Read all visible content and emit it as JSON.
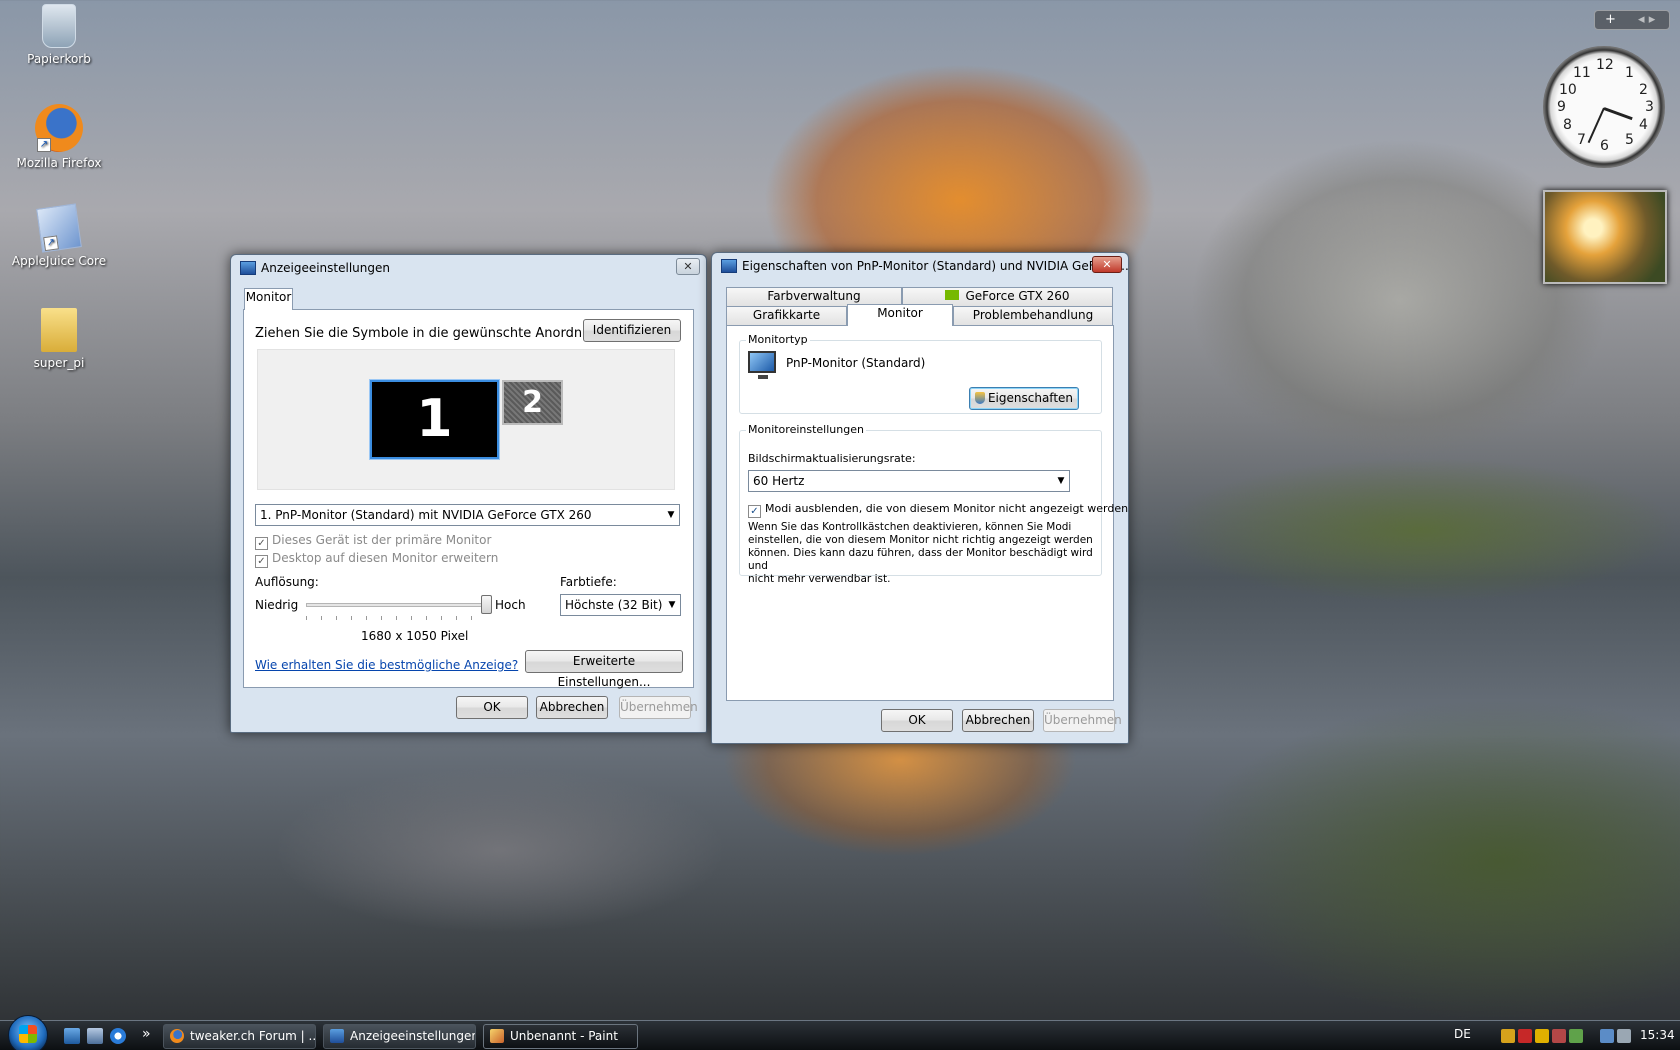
{
  "desktop": {
    "icons": [
      {
        "label": "Papierkorb",
        "icon": "recycle-bin-icon"
      },
      {
        "label": "Mozilla Firefox",
        "icon": "firefox-icon"
      },
      {
        "label": "AppleJuice Core",
        "icon": "applejuice-icon"
      },
      {
        "label": "super_pi",
        "icon": "folder-icon"
      }
    ]
  },
  "gadgets": {
    "sidebar_controls": "+",
    "clock_numbers": [
      "12",
      "1",
      "2",
      "3",
      "4",
      "5",
      "6",
      "7",
      "8",
      "9",
      "10",
      "11"
    ]
  },
  "display_settings": {
    "title": "Anzeigeeinstellungen",
    "tab": "Monitor",
    "instruction": "Ziehen Sie die Symbole in die gewünschte Anordnung.",
    "identify_button": "Identifizieren",
    "monitor_1": "1",
    "monitor_2": "2",
    "monitor_select": "1. PnP-Monitor (Standard) mit NVIDIA GeForce GTX 260",
    "primary_checkbox": "Dieses Gerät ist der primäre Monitor",
    "extend_checkbox": "Desktop auf diesen Monitor erweitern",
    "resolution_label": "Auflösung:",
    "low_label": "Niedrig",
    "high_label": "Hoch",
    "resolution_value": "1680 x 1050 Pixel",
    "resolution_slider_fraction": 1.0,
    "color_depth_label": "Farbtiefe:",
    "color_depth_value": "Höchste (32 Bit)",
    "help_link": "Wie erhalten Sie die bestmögliche Anzeige?",
    "advanced_button": "Erweiterte Einstellungen...",
    "ok": "OK",
    "cancel": "Abbrechen",
    "apply": "Übernehmen"
  },
  "monitor_properties": {
    "title": "Eigenschaften von PnP-Monitor (Standard) und NVIDIA GeForce...",
    "tabs_back": [
      "Farbverwaltung",
      "GeForce GTX 260"
    ],
    "tabs_front": [
      "Grafikkarte",
      "Monitor",
      "Problembehandlung"
    ],
    "active_tab": "Monitor",
    "monitor_type_group": "Monitortyp",
    "monitor_name": "PnP-Monitor (Standard)",
    "properties_button": "Eigenschaften",
    "monitor_settings_group": "Monitoreinstellungen",
    "refresh_label": "Bildschirmaktualisierungsrate:",
    "refresh_value": "60 Hertz",
    "hide_modes_checkbox": "Modi ausblenden, die von diesem Monitor nicht angezeigt werden",
    "hide_modes_checked": true,
    "warning_lines": [
      "Wenn Sie das Kontrollkästchen deaktivieren, können Sie Modi",
      "einstellen, die von diesem Monitor nicht richtig angezeigt werden",
      "können. Dies kann dazu führen, dass der Monitor beschädigt wird und",
      "nicht mehr verwendbar ist."
    ],
    "ok": "OK",
    "cancel": "Abbrechen",
    "apply": "Übernehmen"
  },
  "taskbar": {
    "quick_launch_more": "»",
    "buttons": [
      {
        "label": "tweaker.ch Forum | ...",
        "icon": "firefox-icon"
      },
      {
        "label": "Anzeigeeinstellungen",
        "icon": "display-settings-icon"
      },
      {
        "label": "Unbenannt - Paint",
        "icon": "paint-icon"
      }
    ],
    "language": "DE",
    "time": "15:34"
  },
  "colors": {
    "accent": "#3c7fb1",
    "link": "#0645ad",
    "monitor_selected": "#000000"
  }
}
